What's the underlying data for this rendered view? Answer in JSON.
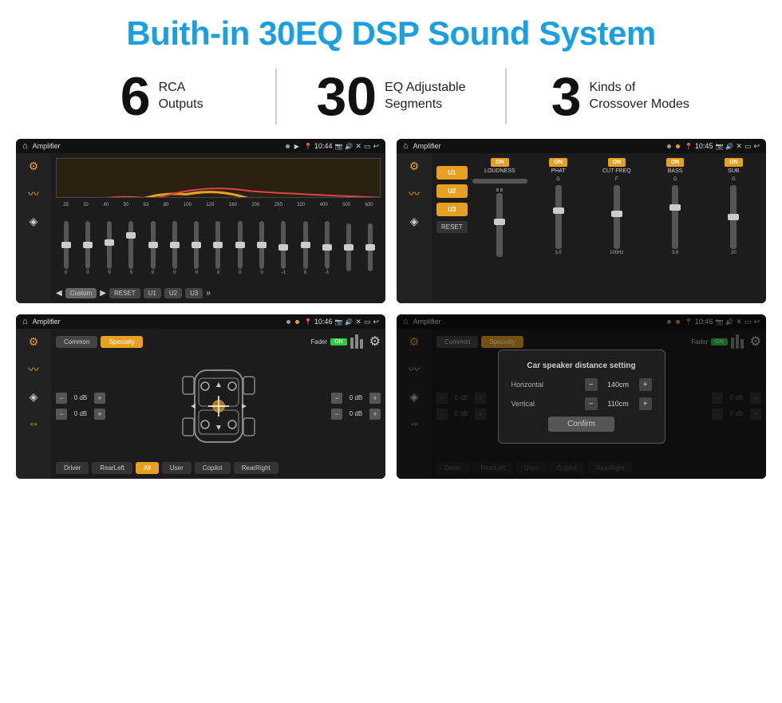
{
  "header": {
    "title": "Buith-in 30EQ DSP Sound System"
  },
  "stats": [
    {
      "number": "6",
      "label_line1": "RCA",
      "label_line2": "Outputs"
    },
    {
      "number": "30",
      "label_line1": "EQ Adjustable",
      "label_line2": "Segments"
    },
    {
      "number": "3",
      "label_line1": "Kinds of",
      "label_line2": "Crossover Modes"
    }
  ],
  "screens": [
    {
      "id": "screen1",
      "status": {
        "title": "Amplifier",
        "time": "10:44"
      },
      "type": "eq"
    },
    {
      "id": "screen2",
      "status": {
        "title": "Amplifier",
        "time": "10:45"
      },
      "type": "amp"
    },
    {
      "id": "screen3",
      "status": {
        "title": "Amplifier",
        "time": "10:46"
      },
      "type": "specialty"
    },
    {
      "id": "screen4",
      "status": {
        "title": "Amplifier",
        "time": "10:46"
      },
      "type": "specialty-dialog"
    }
  ],
  "eq": {
    "frequencies": [
      "25",
      "32",
      "40",
      "50",
      "63",
      "80",
      "100",
      "125",
      "160",
      "200",
      "250",
      "320",
      "400",
      "500",
      "630"
    ],
    "values": [
      "0",
      "0",
      "0",
      "5",
      "0",
      "0",
      "0",
      "0",
      "0",
      "0",
      "-1",
      "0",
      "-1"
    ],
    "preset": "Custom",
    "buttons": [
      "RESET",
      "U1",
      "U2",
      "U3"
    ]
  },
  "amp_channels": {
    "presets": [
      "U1",
      "U2",
      "U3"
    ],
    "channels": [
      {
        "label": "LOUDNESS",
        "toggle": "ON"
      },
      {
        "label": "PHAT",
        "toggle": "ON"
      },
      {
        "label": "CUT FREQ",
        "toggle": "ON"
      },
      {
        "label": "BASS",
        "toggle": "ON"
      },
      {
        "label": "SUB",
        "toggle": "ON"
      }
    ],
    "reset": "RESET"
  },
  "specialty": {
    "tabs": [
      "Common",
      "Specialty"
    ],
    "fader_label": "Fader",
    "fader_toggle": "ON",
    "db_values": [
      "0 dB",
      "0 dB",
      "0 dB",
      "0 dB"
    ],
    "bottom_buttons": [
      "Driver",
      "RearLeft",
      "All",
      "User",
      "Copilot",
      "RearRight"
    ]
  },
  "dialog": {
    "title": "Car speaker distance setting",
    "fields": [
      {
        "label": "Horizontal",
        "value": "140cm"
      },
      {
        "label": "Vertical",
        "value": "110cm"
      }
    ],
    "confirm_label": "Confirm"
  }
}
